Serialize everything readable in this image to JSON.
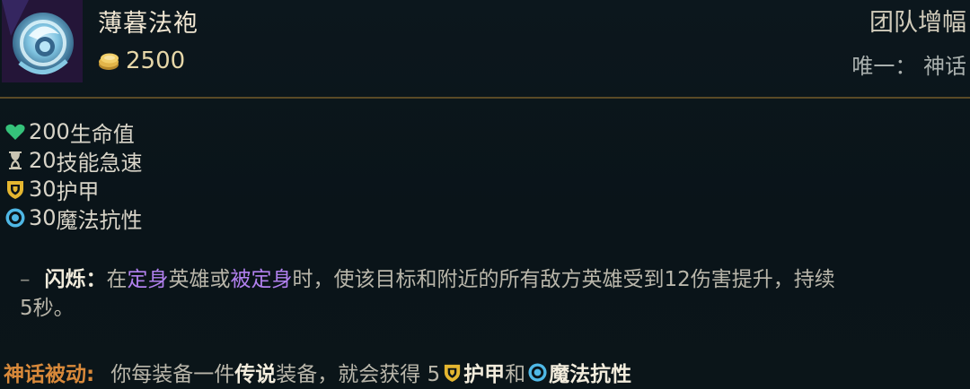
{
  "item": {
    "name": "薄暮法袍",
    "cost": "2500",
    "icon": "dusk-robe-icon"
  },
  "header": {
    "category": "团队增幅",
    "unique": "唯一：  神话"
  },
  "stats": [
    {
      "icon": "heart-icon",
      "color": "#35c27a",
      "value": "200",
      "label": "生命值"
    },
    {
      "icon": "hourglass-icon",
      "color": "#c9c4b2",
      "value": "20",
      "label": "技能急速"
    },
    {
      "icon": "armor-shield-icon",
      "color": "#e5b630",
      "value": "30",
      "label": "护甲"
    },
    {
      "icon": "magic-resist-icon",
      "color": "#4fb8e6",
      "value": "30",
      "label": "魔法抗性"
    }
  ],
  "passive": {
    "dash": "–",
    "name": "闪烁：",
    "t1": "在",
    "k1": "定身",
    "t2": "英雄或",
    "k2": "被定身",
    "t3": "时，使该目标和附近的所有敌方英雄受到12伤害提升，持续",
    "t4": "5秒。"
  },
  "mythic": {
    "label": "神话被动:",
    "t1": "你每装备一件",
    "k1": "传说",
    "t2": "装备，就会获得 5 ",
    "k2": "护甲",
    "t3": "和",
    "k3": "魔法抗性"
  },
  "colors": {
    "accent_gold": "#c89b3c",
    "mythic_orange": "#d8893a",
    "keyword_purple": "#b180ee"
  }
}
